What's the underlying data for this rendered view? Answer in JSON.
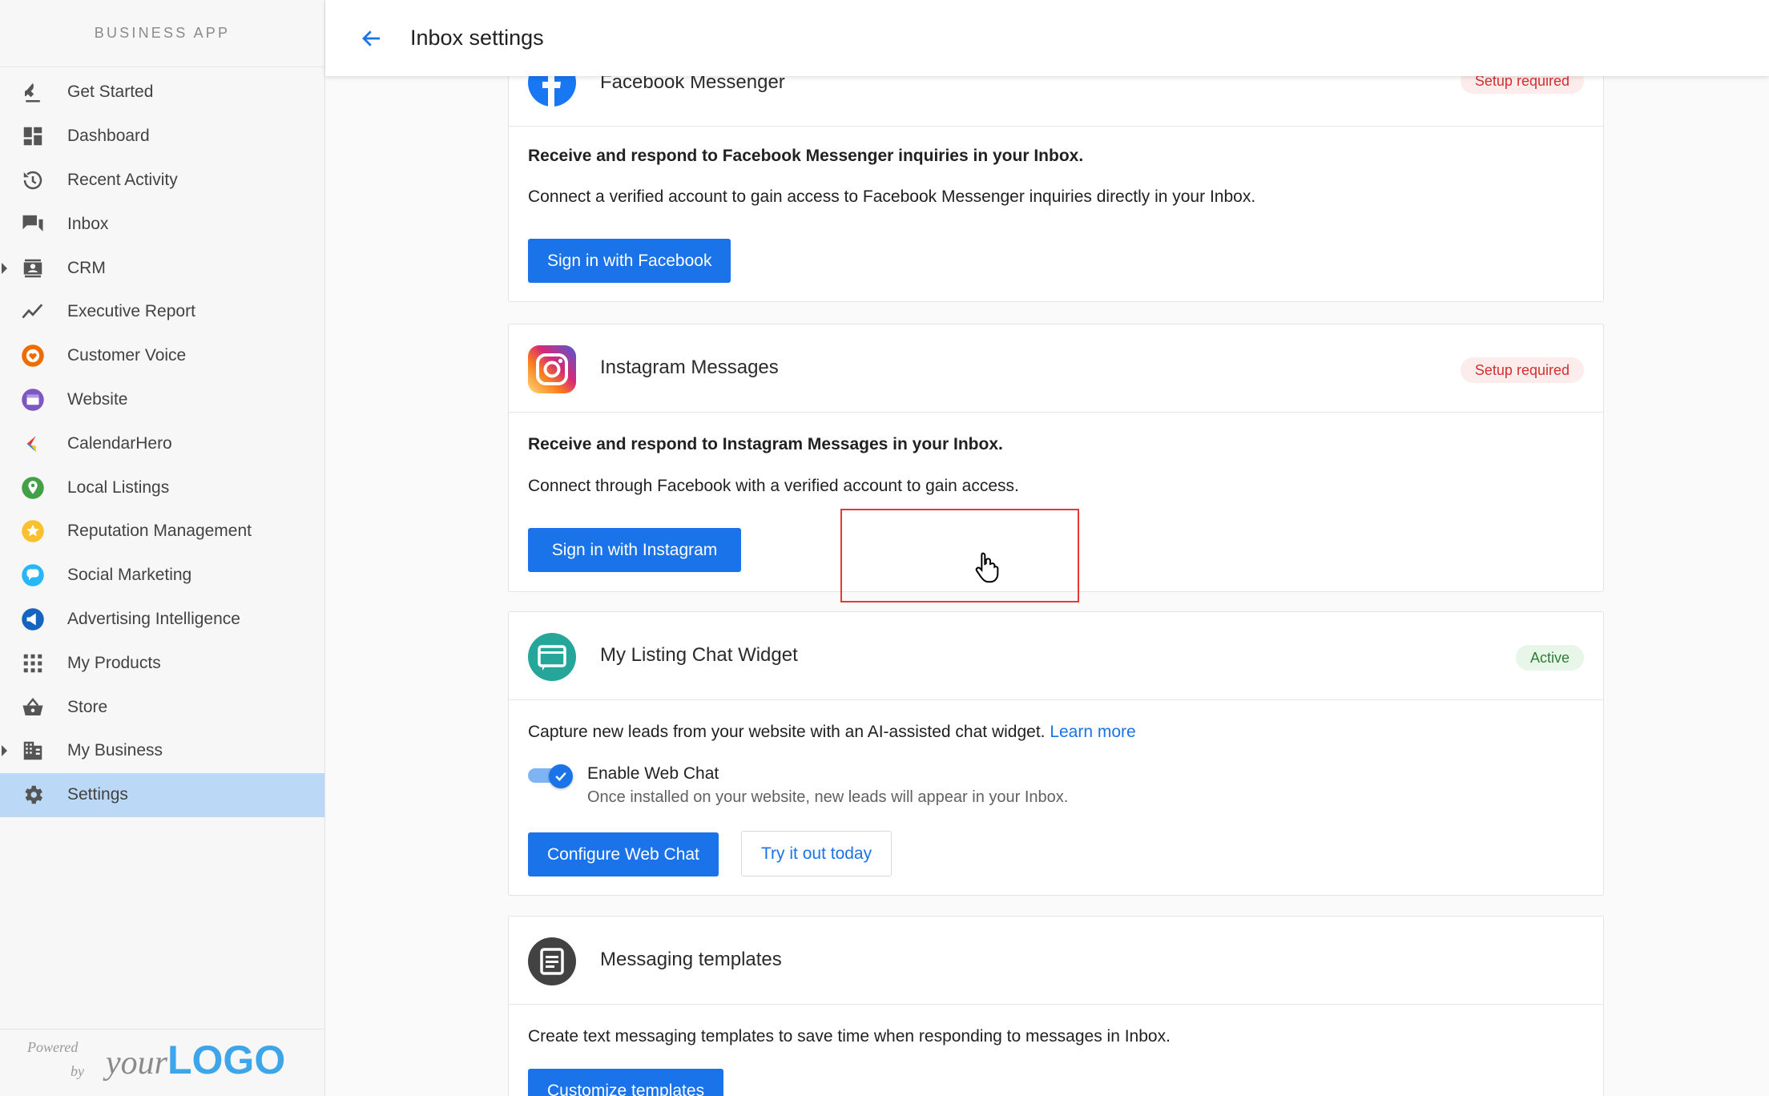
{
  "sidebar": {
    "brand": "BUSINESS APP",
    "items": [
      {
        "label": "Get Started",
        "icon": "rocket-icon"
      },
      {
        "label": "Dashboard",
        "icon": "dashboard-icon"
      },
      {
        "label": "Recent Activity",
        "icon": "history-icon"
      },
      {
        "label": "Inbox",
        "icon": "chat-icon"
      },
      {
        "label": "CRM",
        "icon": "contacts-icon"
      },
      {
        "label": "Executive Report",
        "icon": "trend-icon"
      },
      {
        "label": "Customer Voice",
        "icon": "customer-voice-icon"
      },
      {
        "label": "Website",
        "icon": "website-icon"
      },
      {
        "label": "CalendarHero",
        "icon": "calendarhero-icon"
      },
      {
        "label": "Local Listings",
        "icon": "location-pin-icon"
      },
      {
        "label": "Reputation Management",
        "icon": "star-icon"
      },
      {
        "label": "Social Marketing",
        "icon": "social-marketing-icon"
      },
      {
        "label": "Advertising Intelligence",
        "icon": "megaphone-icon"
      },
      {
        "label": "My Products",
        "icon": "apps-grid-icon"
      },
      {
        "label": "Store",
        "icon": "basket-icon"
      },
      {
        "label": "My Business",
        "icon": "building-icon"
      },
      {
        "label": "Settings",
        "icon": "gear-icon"
      }
    ],
    "active_item": "Settings",
    "footer": {
      "powered": "Powered",
      "by": "by",
      "logo_your": "your",
      "logo_logo": "LOGO"
    }
  },
  "header": {
    "title": "Inbox settings"
  },
  "cards": {
    "facebook": {
      "title": "Facebook Messenger",
      "badge": "Setup required",
      "headline": "Receive and respond to Facebook Messenger inquiries in your Inbox.",
      "description": "Connect a verified account to gain access to Facebook Messenger inquiries directly in your Inbox.",
      "button": "Sign in with Facebook"
    },
    "instagram": {
      "title": "Instagram Messages",
      "badge": "Setup required",
      "headline": "Receive and respond to Instagram Messages in your Inbox.",
      "description": "Connect through Facebook with a verified account to gain access.",
      "button": "Sign in with Instagram"
    },
    "chat_widget": {
      "title": "My Listing Chat Widget",
      "badge": "Active",
      "description": "Capture new leads from your website with an AI-assisted chat widget.",
      "link": "Learn more",
      "toggle_label": "Enable Web Chat",
      "toggle_sub": "Once installed on your website, new leads will appear in your Inbox.",
      "toggle_on": true,
      "button_primary": "Configure Web Chat",
      "button_secondary": "Try it out today"
    },
    "templates": {
      "title": "Messaging templates",
      "description": "Create text messaging templates to save time when responding to messages in Inbox.",
      "button": "Customize templates"
    }
  },
  "colors": {
    "accent": "#1a73e8",
    "active_nav": "#bbd9f7",
    "warn": "#d32f2f",
    "ok": "#2e7d32"
  }
}
